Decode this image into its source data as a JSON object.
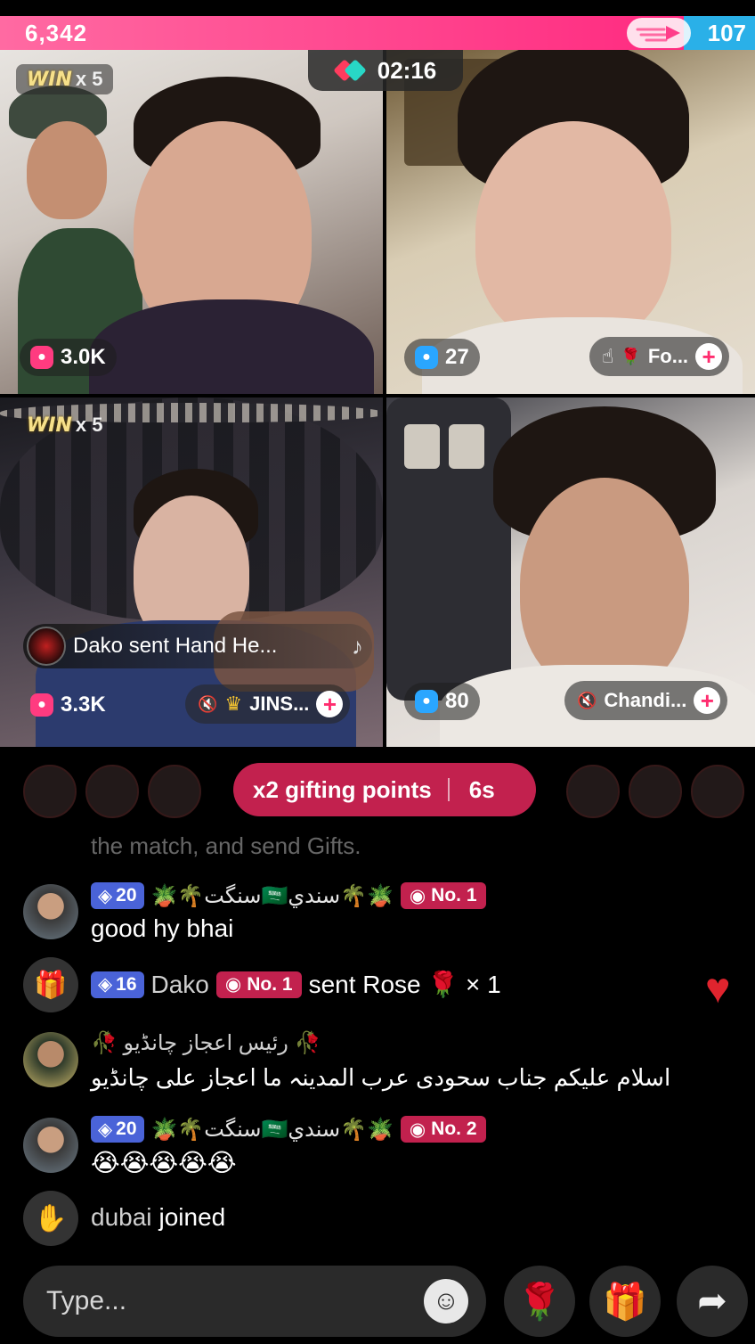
{
  "score": {
    "left": "6,342",
    "right": "107",
    "left_color": "#ff3d8a",
    "right_color": "#2ab0e8"
  },
  "timer": {
    "value": "02:16"
  },
  "tiles": [
    {
      "win_label": "WIN",
      "win_mult": "x 5",
      "likes": "3.0K",
      "likes_icon": "pink-flame-icon"
    },
    {
      "likes": "27",
      "likes_icon": "blue-flame-icon",
      "name": "Fo..."
    },
    {
      "win_label": "WIN",
      "win_mult": "x 5",
      "likes": "3.3K",
      "likes_icon": "pink-flame-icon",
      "name": "JINS...",
      "toast": "Dako sent Hand He..."
    },
    {
      "likes": "80",
      "likes_icon": "blue-flame-icon",
      "name": "Chandi..."
    }
  ],
  "gifting": {
    "label": "x2 gifting points",
    "time": "6s"
  },
  "chat": {
    "faded": "the match, and send Gifts.",
    "messages": [
      {
        "level": "20",
        "name": "🪴🌴سنگت🇸🇦سندي🌴🪴",
        "rank": "No. 1",
        "text": "good hy bhai"
      },
      {
        "level": "16",
        "name": "Dako",
        "rank": "No. 1",
        "text": "sent Rose 🌹 × 1"
      },
      {
        "name": "🥀 رئیس اعجاز چانڈیو 🥀",
        "text": "اسلام علیکم جناب سحودی عرب المدینہ ما اعجاز علی چانڈیو"
      },
      {
        "level": "20",
        "name": "🪴🌴سنگت🇸🇦سندي🌴🪴",
        "rank": "No. 2",
        "text": "😭😭😭😭😭"
      },
      {
        "name": "dubai",
        "text": "joined"
      }
    ]
  },
  "input": {
    "placeholder": "Type..."
  }
}
